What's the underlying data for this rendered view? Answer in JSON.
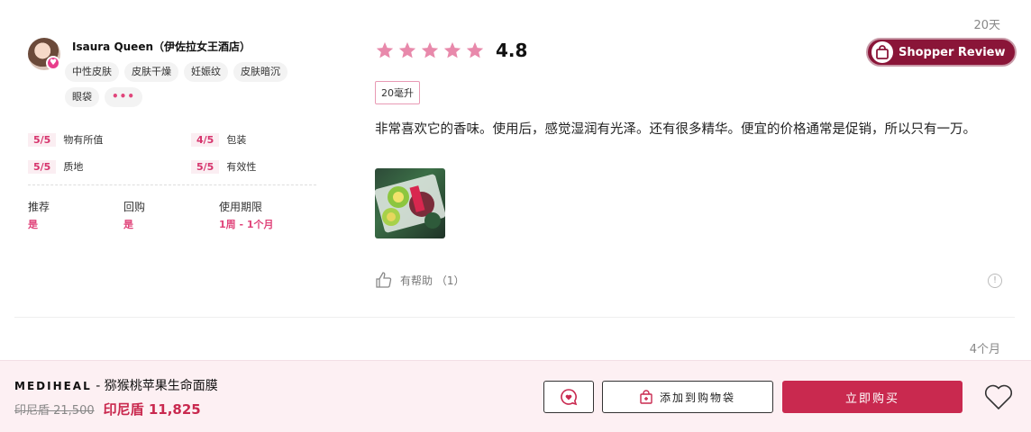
{
  "review": {
    "age": "20天",
    "author": {
      "name": "Isaura Queen（伊佐拉女王酒店）",
      "tags": [
        "中性皮肤",
        "皮肤干燥",
        "妊娠纹",
        "皮肤暗沉",
        "眼袋"
      ],
      "more": "•••"
    },
    "ratings": [
      {
        "score": "5/5",
        "label": "物有所值"
      },
      {
        "score": "4/5",
        "label": "包装"
      },
      {
        "score": "5/5",
        "label": "质地"
      },
      {
        "score": "5/5",
        "label": "有效性"
      }
    ],
    "meta": [
      {
        "label": "推荐",
        "value": "是"
      },
      {
        "label": "回购",
        "value": "是"
      },
      {
        "label": "使用期限",
        "value": "1周 - 1个月"
      }
    ],
    "stars": 5,
    "rating": "4.8",
    "badge": "Shopper Review",
    "size": "20毫升",
    "text": "非常喜欢它的香味。使用后，感觉湿润有光泽。还有很多精华。便宜的价格通常是促销，所以只有一万。",
    "helpful": "有帮助 （1）",
    "info": "!"
  },
  "next_review": {
    "age": "4个月"
  },
  "bottom_bar": {
    "brand": "MEDIHEAL",
    "separator": " - ",
    "product": "猕猴桃苹果生命面膜",
    "old_price": "印尼盾 21,500",
    "new_price": "印尼盾 11,825",
    "add_to_bag": "添加到购物袋",
    "buy_now": "立即购买"
  },
  "colors": {
    "accent": "#c9294f",
    "star": "#e889ab",
    "badge": "#8a1538"
  }
}
